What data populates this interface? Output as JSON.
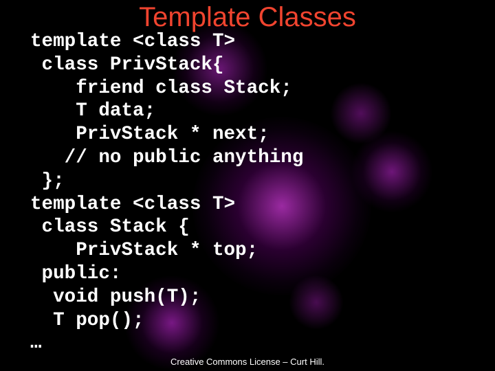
{
  "slide": {
    "title": "Template Classes",
    "code_lines": [
      "template <class T>",
      " class PrivStack{",
      "    friend class Stack;",
      "    T data;",
      "    PrivStack * next;",
      "   // no public anything",
      " };",
      "template <class T>",
      " class Stack {",
      "    PrivStack * top;",
      " public:",
      "  void push(T);",
      "  T pop();",
      "…"
    ],
    "footer": "Creative Commons License – Curt Hill."
  }
}
